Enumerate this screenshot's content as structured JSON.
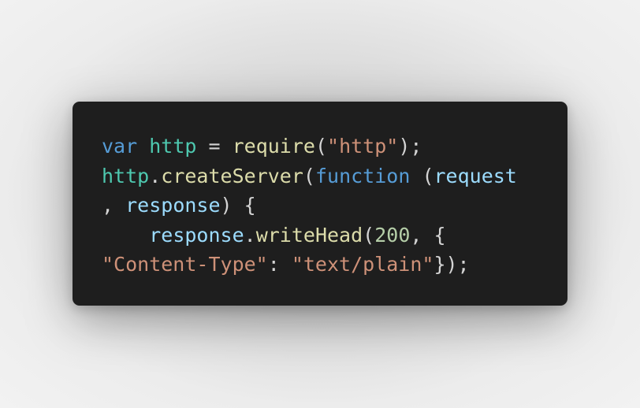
{
  "colors": {
    "keyword": "#569cd6",
    "identifier": "#4ec9b0",
    "variable": "#9cdcfe",
    "function": "#dcdcaa",
    "string": "#ce9178",
    "number": "#b5cea8",
    "punctuation": "#d4d4d4",
    "background": "#1e1e1e"
  },
  "code": {
    "lines": [
      [
        {
          "text": "var",
          "type": "keyword"
        },
        {
          "text": " ",
          "type": "punctuation"
        },
        {
          "text": "http",
          "type": "identifier"
        },
        {
          "text": " = ",
          "type": "punctuation"
        },
        {
          "text": "require",
          "type": "function"
        },
        {
          "text": "(",
          "type": "punctuation"
        },
        {
          "text": "\"http\"",
          "type": "string"
        },
        {
          "text": ");",
          "type": "punctuation"
        }
      ],
      [
        {
          "text": "http",
          "type": "identifier"
        },
        {
          "text": ".",
          "type": "punctuation"
        },
        {
          "text": "createServer",
          "type": "function"
        },
        {
          "text": "(",
          "type": "punctuation"
        },
        {
          "text": "function",
          "type": "keyword"
        },
        {
          "text": " (",
          "type": "punctuation"
        },
        {
          "text": "request",
          "type": "variable"
        }
      ],
      [
        {
          "text": ", ",
          "type": "punctuation"
        },
        {
          "text": "response",
          "type": "variable"
        },
        {
          "text": ") {",
          "type": "punctuation"
        }
      ],
      [
        {
          "text": "    ",
          "type": "punctuation"
        },
        {
          "text": "response",
          "type": "variable"
        },
        {
          "text": ".",
          "type": "punctuation"
        },
        {
          "text": "writeHead",
          "type": "function"
        },
        {
          "text": "(",
          "type": "punctuation"
        },
        {
          "text": "200",
          "type": "number"
        },
        {
          "text": ", {",
          "type": "punctuation"
        }
      ],
      [
        {
          "text": "\"Content-Type\"",
          "type": "string"
        },
        {
          "text": ": ",
          "type": "punctuation"
        },
        {
          "text": "\"text/plain\"",
          "type": "string"
        },
        {
          "text": "});",
          "type": "punctuation"
        }
      ]
    ]
  }
}
